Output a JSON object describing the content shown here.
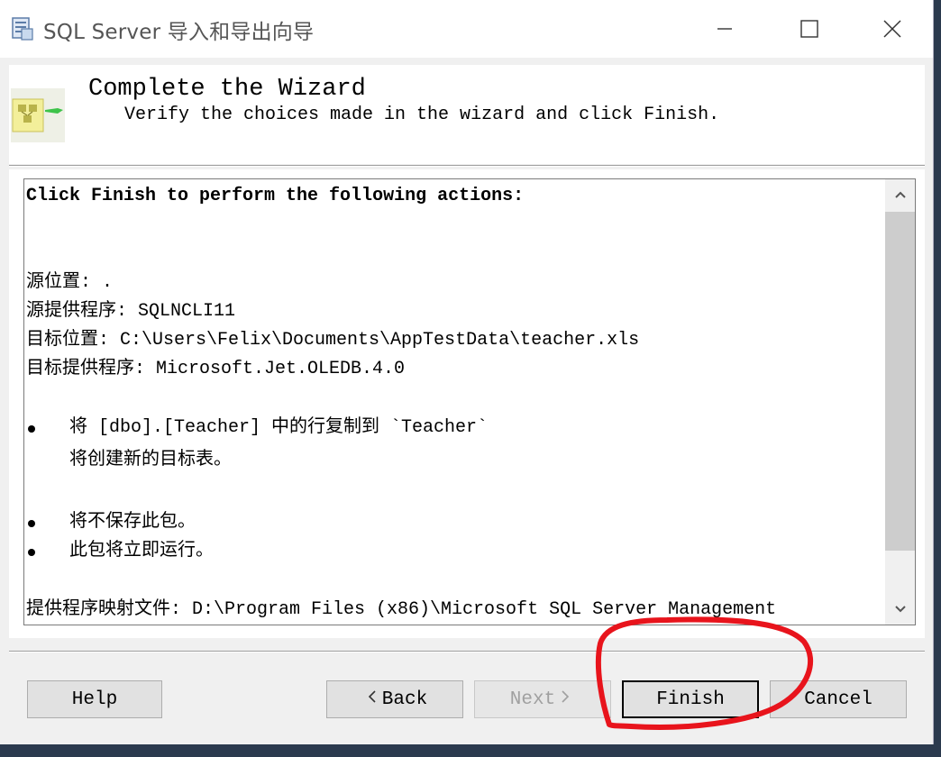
{
  "window": {
    "title": "SQL Server 导入和导出向导",
    "controls": {
      "minimize": "minimize",
      "maximize": "maximize",
      "close": "close"
    }
  },
  "header": {
    "title": "Complete the Wizard",
    "subtitle": "Verify the choices made in the wizard and click Finish."
  },
  "summary": {
    "heading": "Click Finish to perform the following actions:",
    "source_location": "源位置: .",
    "source_provider": "源提供程序: SQLNCLI11",
    "target_location": "目标位置: C:\\Users\\Felix\\Documents\\AppTestData\\teacher.xls",
    "target_provider": "目标提供程序: Microsoft.Jet.OLEDB.4.0",
    "bullet1_line1": "将 [dbo].[Teacher] 中的行复制到 `Teacher`",
    "bullet1_line2": "将创建新的目标表。",
    "bullet2": "将不保存此包。",
    "bullet3": "此包将立即运行。",
    "mapping_file": "提供程序映射文件: D:\\Program Files (x86)\\Microsoft SQL Server Management"
  },
  "buttons": {
    "help": "Help",
    "back": "Back",
    "next": "Next",
    "finish": "Finish",
    "cancel": "Cancel"
  },
  "icons": {
    "title_icon": "wizard-app-icon",
    "header_icon": "export-wizard-icon",
    "scroll_up": "chevron-up-icon",
    "scroll_down": "chevron-down-icon",
    "back": "chevron-left-icon",
    "next": "chevron-right-icon"
  },
  "annotation": {
    "color": "#e8141c",
    "target": "finish-button"
  }
}
